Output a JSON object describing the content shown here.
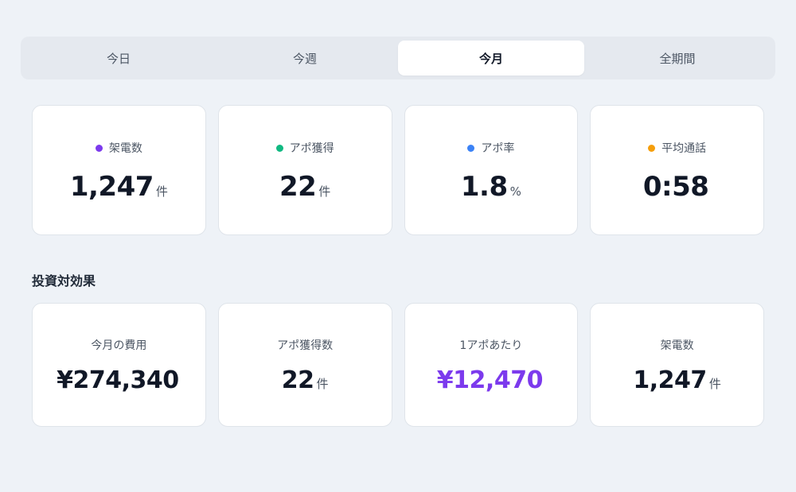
{
  "tabs": [
    {
      "label": "今日",
      "active": false
    },
    {
      "label": "今週",
      "active": false
    },
    {
      "label": "今月",
      "active": true
    },
    {
      "label": "全期間",
      "active": false
    }
  ],
  "stats": [
    {
      "label": "架電数",
      "value": "1,247",
      "unit": "件",
      "dot_color": "#7c3aed"
    },
    {
      "label": "アポ獲得",
      "value": "22",
      "unit": "件",
      "dot_color": "#10b981"
    },
    {
      "label": "アポ率",
      "value": "1.8",
      "unit": "%",
      "dot_color": "#3b82f6"
    },
    {
      "label": "平均通話",
      "value": "0:58",
      "unit": "",
      "dot_color": "#f59e0b"
    }
  ],
  "roi": {
    "title": "投資対効果",
    "cards": [
      {
        "label": "今月の費用",
        "value": "¥274,340",
        "unit": "",
        "value_color": "#111827"
      },
      {
        "label": "アポ獲得数",
        "value": "22",
        "unit": "件",
        "value_color": "#111827"
      },
      {
        "label": "1アポあたり",
        "value": "¥12,470",
        "unit": "",
        "value_color": "#7c3aed"
      },
      {
        "label": "架電数",
        "value": "1,247",
        "unit": "件",
        "value_color": "#111827"
      }
    ]
  }
}
